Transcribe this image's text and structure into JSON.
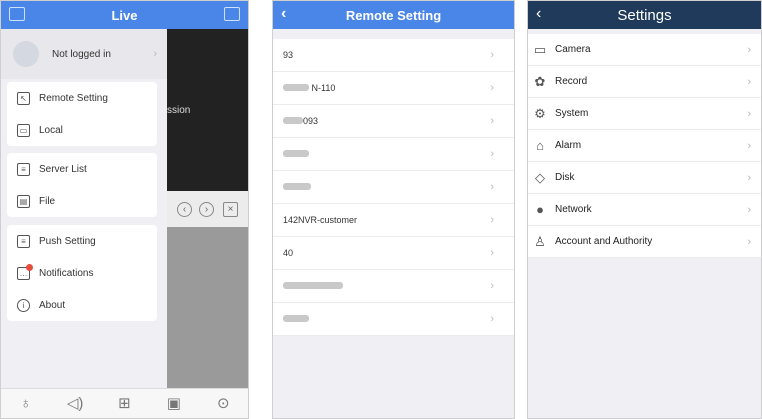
{
  "live": {
    "title": "Live",
    "profile_label": "Not logged in",
    "video_overlay_text": "ssion",
    "menu_groups": [
      [
        {
          "label": "Remote Setting",
          "icon": "remote-setting-icon"
        },
        {
          "label": "Local",
          "icon": "local-icon"
        }
      ],
      [
        {
          "label": "Server List",
          "icon": "server-list-icon"
        },
        {
          "label": "File",
          "icon": "file-icon"
        }
      ],
      [
        {
          "label": "Push Setting",
          "icon": "push-setting-icon"
        },
        {
          "label": "Notifications",
          "icon": "notifications-icon"
        },
        {
          "label": "About",
          "icon": "about-icon"
        }
      ]
    ],
    "bottom_icons": [
      "microphone-icon",
      "speaker-icon",
      "grid-layout-icon",
      "playback-icon",
      "more-icon"
    ]
  },
  "remote": {
    "title": "Remote Setting",
    "rows": [
      "93",
      "N-110",
      "093",
      "",
      "",
      "142NVR-customer",
      "40",
      "",
      ""
    ]
  },
  "settings": {
    "title": "Settings",
    "items": [
      {
        "label": "Camera",
        "icon": "camera-icon"
      },
      {
        "label": "Record",
        "icon": "record-icon"
      },
      {
        "label": "System",
        "icon": "system-gear-icon"
      },
      {
        "label": "Alarm",
        "icon": "alarm-bell-icon"
      },
      {
        "label": "Disk",
        "icon": "disk-icon"
      },
      {
        "label": "Network",
        "icon": "network-globe-icon"
      },
      {
        "label": "Account and Authority",
        "icon": "account-icon"
      }
    ]
  },
  "glyphs": {
    "chevron": "›",
    "back": "‹"
  }
}
